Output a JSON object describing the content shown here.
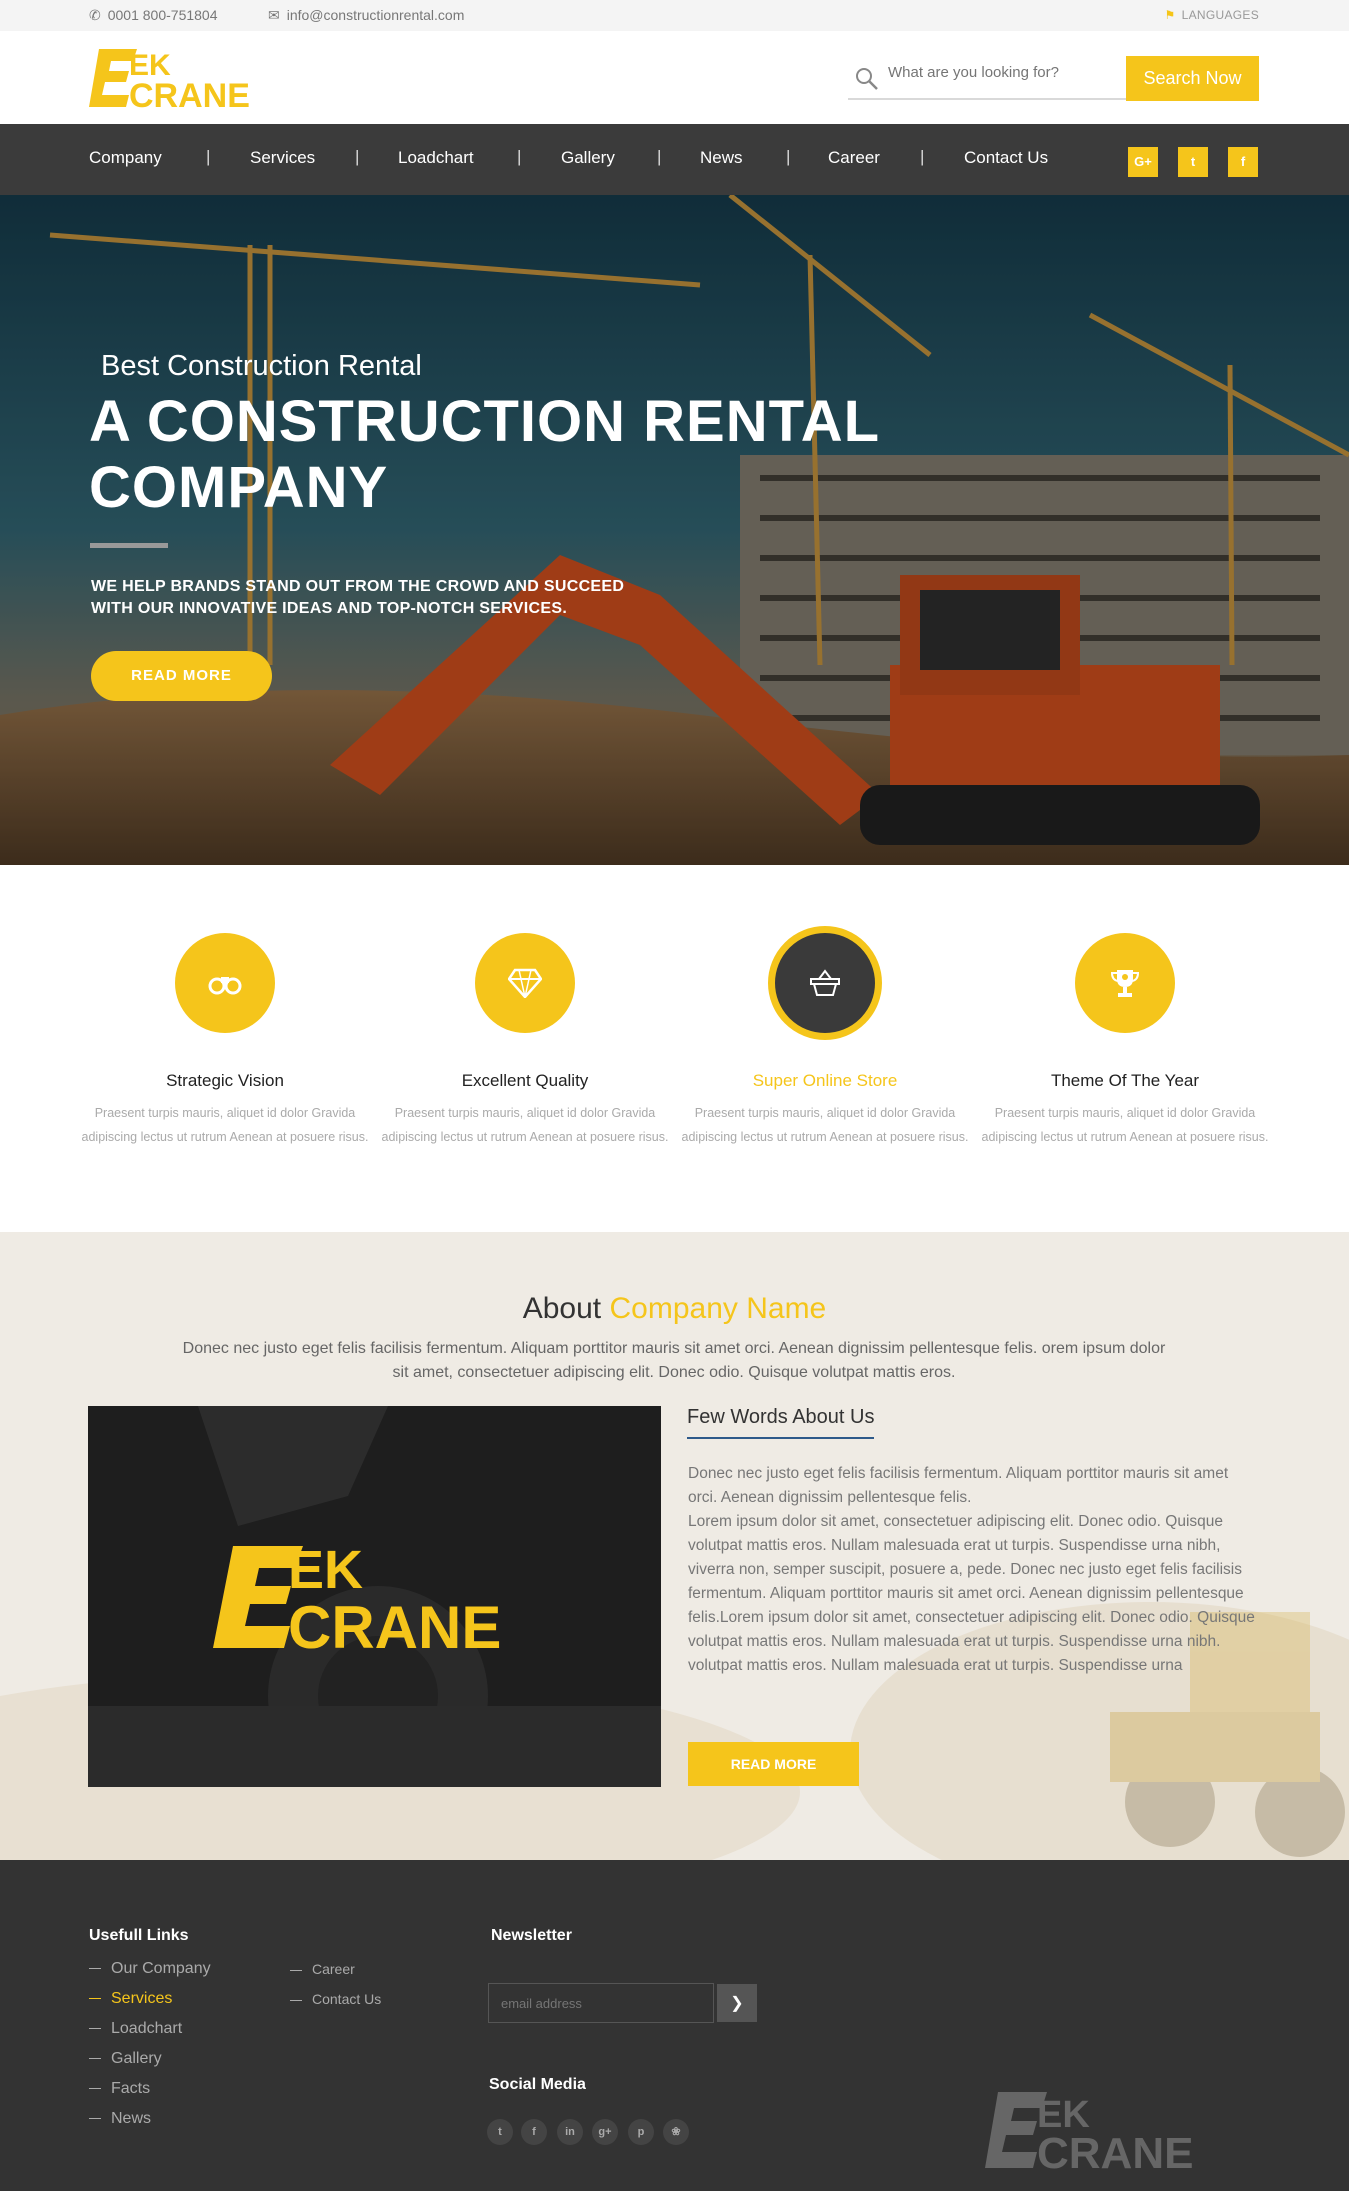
{
  "topbar": {
    "phone": "0001 800-751804",
    "email": "info@constructionrental.com",
    "languages": "LANGUAGES"
  },
  "header": {
    "logo_top": "EK",
    "logo_bottom": "CRANE",
    "search_placeholder": "What are you looking for?",
    "search_button": "Search Now"
  },
  "nav": {
    "items": [
      "Company",
      "Services",
      "Loadchart",
      "Gallery",
      "News",
      "Career",
      "Contact Us"
    ],
    "social": [
      "G+",
      "t",
      "f"
    ]
  },
  "hero": {
    "subtitle": "Best Construction Rental",
    "title": "A CONSTRUCTION RENTAL COMPANY",
    "description": "WE HELP BRANDS STAND OUT FROM THE CROWD AND SUCCEED WITH OUR INNOVATIVE IDEAS AND TOP-NOTCH SERVICES.",
    "button": "READ MORE"
  },
  "features": [
    {
      "icon": "binoculars-icon",
      "title": "Strategic Vision",
      "text": "Praesent turpis mauris, aliquet id dolor Gravida adipiscing lectus ut rutrum Aenean at posuere risus."
    },
    {
      "icon": "diamond-icon",
      "title": "Excellent Quality",
      "text": "Praesent turpis mauris, aliquet id dolor Gravida adipiscing lectus ut rutrum Aenean at posuere risus."
    },
    {
      "icon": "basket-icon",
      "title": "Super Online Store",
      "text": "Praesent turpis mauris, aliquet id dolor Gravida adipiscing lectus ut rutrum Aenean at posuere risus."
    },
    {
      "icon": "trophy-icon",
      "title": "Theme Of The Year",
      "text": "Praesent turpis mauris, aliquet id dolor Gravida adipiscing lectus ut rutrum Aenean at posuere risus."
    }
  ],
  "about": {
    "heading_plain": "About",
    "heading_highlight": "Company Name",
    "lead": "Donec nec justo eget felis facilisis fermentum. Aliquam porttitor mauris sit amet orci. Aenean dignissim pellentesque felis. orem ipsum dolor sit amet, consectetuer adipiscing elit. Donec odio. Quisque volutpat mattis eros.",
    "subheading": "Few Words About Us",
    "para1": "Donec nec justo eget felis facilisis fermentum. Aliquam porttitor mauris sit amet orci. Aenean dignissim pellentesque felis.",
    "para2": "Lorem ipsum dolor sit amet, consectetuer adipiscing elit. Donec odio. Quisque volutpat mattis eros. Nullam malesuada erat ut turpis. Suspendisse urna nibh, viverra non, semper suscipit, posuere a, pede. Donec nec justo eget felis facilisis fermentum. Aliquam porttitor mauris sit amet orci. Aenean dignissim pellentesque felis.Lorem ipsum dolor sit amet, consectetuer adipiscing elit. Donec odio. Quisque volutpat mattis eros. Nullam malesuada erat ut turpis. Suspendisse urna nibh.",
    "para3": "volutpat mattis eros. Nullam malesuada erat ut turpis. Suspendisse urna",
    "button": "READ MORE"
  },
  "footer": {
    "links_heading": "Usefull Links",
    "links_col1": [
      "Our Company",
      "Services",
      "Loadchart",
      "Gallery",
      "Facts",
      "News"
    ],
    "links_col2": [
      "Career",
      "Contact Us"
    ],
    "newsletter_heading": "Newsletter",
    "newsletter_placeholder": "email address",
    "social_heading": "Social Media",
    "social_icons": [
      "twitter-icon",
      "facebook-icon",
      "linkedin-icon",
      "google-plus-icon",
      "pinterest-icon",
      "dribbble-icon"
    ]
  },
  "colors": {
    "accent": "#f5c51b",
    "nav_bg": "#3b3b3b",
    "footer_bg": "#333333"
  }
}
